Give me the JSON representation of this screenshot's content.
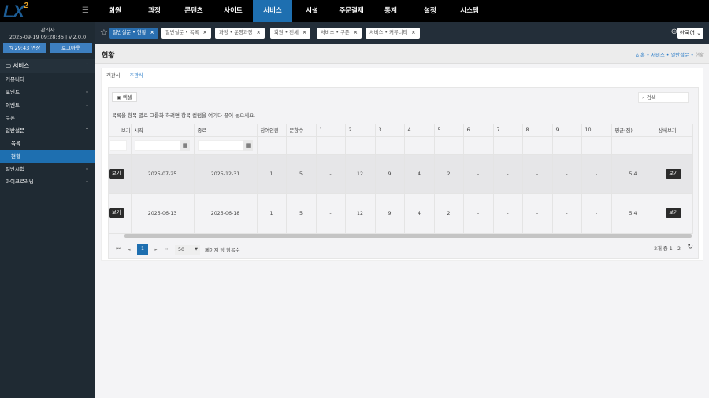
{
  "logo": {
    "text": "LX",
    "sup": "2"
  },
  "nav": [
    "회원",
    "과정",
    "콘텐츠",
    "사이트",
    "서비스",
    "시설",
    "주문결제",
    "통계",
    "설정",
    "시스템"
  ],
  "nav_active": "서비스",
  "user": {
    "role": "관리자",
    "datetime": "2025-09-19 09:28:36",
    "version": "v.2.0.0",
    "extend": "29:43 연장",
    "logout": "로그아웃"
  },
  "sidebar": {
    "section": "서비스",
    "items": [
      {
        "label": "커뮤니티",
        "chev": ""
      },
      {
        "label": "포인트",
        "chev": "⌄"
      },
      {
        "label": "이벤트",
        "chev": "⌄"
      },
      {
        "label": "쿠폰",
        "chev": ""
      },
      {
        "label": "일반설문",
        "chev": "⌃"
      },
      {
        "label": "목록",
        "chev": "",
        "sub": true
      },
      {
        "label": "현황",
        "chev": "",
        "sub": true,
        "active": true
      },
      {
        "label": "일반시험",
        "chev": "⌄"
      },
      {
        "label": "마이크로러닝",
        "chev": "⌄"
      }
    ]
  },
  "tabs": [
    {
      "label": "일반설문 • 현황",
      "active": true
    },
    {
      "label": "일반설문 • 목록"
    },
    {
      "label": "과정 • 운영과정"
    },
    {
      "label": "회원 • 전체"
    },
    {
      "label": "서비스 • 쿠폰"
    },
    {
      "label": "서비스 • 커뮤니티"
    }
  ],
  "language": "한국어",
  "page": {
    "title": "현황",
    "breadcrumb": [
      "홈",
      "서비스",
      "일반설문",
      "현황"
    ]
  },
  "subtabs": [
    "객관식",
    "주관식"
  ],
  "grid": {
    "excel": "엑셀",
    "search_placeholder": "검색",
    "group_hint": "목록을 항목 별로 그룹화 하려면 항목 컬럼을 여기다 끌어 놓으세요.",
    "columns": [
      "보기",
      "시작",
      "종료",
      "참여인원",
      "문항수",
      "1",
      "2",
      "3",
      "4",
      "5",
      "6",
      "7",
      "8",
      "9",
      "10",
      "평균(점)",
      "상세보기"
    ],
    "rows": [
      {
        "cells": [
          "보기",
          "2025-07-25",
          "2025-12-31",
          "1",
          "5",
          "-",
          "12",
          "9",
          "4",
          "2",
          "-",
          "-",
          "-",
          "-",
          "-",
          "5.4",
          "보기"
        ]
      },
      {
        "cells": [
          "보기",
          "2025-06-13",
          "2025-06-18",
          "1",
          "5",
          "-",
          "12",
          "9",
          "4",
          "2",
          "-",
          "-",
          "-",
          "-",
          "-",
          "5.4",
          "보기"
        ]
      }
    ],
    "pager": {
      "current": "1",
      "page_size": "50",
      "page_size_label": "페이지 당 항목수",
      "info": "2개 중 1 - 2"
    }
  },
  "colors": {
    "accent": "#1e6fb0",
    "sidebar": "#1f2a33",
    "topbar": "#000000"
  }
}
